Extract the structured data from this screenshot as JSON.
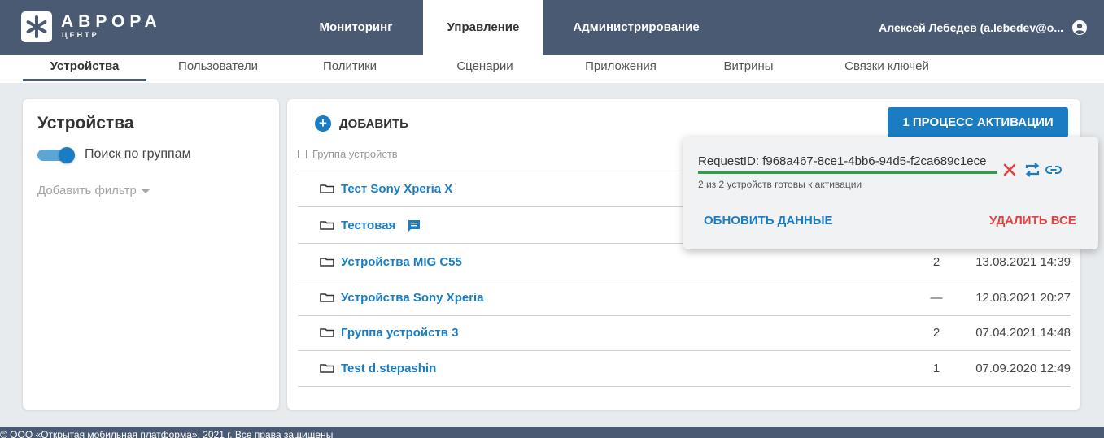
{
  "brand": {
    "title": "АВРОРА",
    "subtitle": "ЦЕНТР"
  },
  "main_nav": [
    {
      "label": "Мониторинг"
    },
    {
      "label": "Управление"
    },
    {
      "label": "Администрирование"
    }
  ],
  "user": {
    "name": "Алексей Лебедев (a.lebedev@o..."
  },
  "sub_nav": [
    {
      "label": "Устройства"
    },
    {
      "label": "Пользователи"
    },
    {
      "label": "Политики"
    },
    {
      "label": "Сценарии"
    },
    {
      "label": "Приложения"
    },
    {
      "label": "Витрины"
    },
    {
      "label": "Связки ключей"
    }
  ],
  "left_panel": {
    "title": "Устройства",
    "group_search_label": "Поиск по группам",
    "group_search_enabled": true,
    "add_filter_label": "Добавить фильтр"
  },
  "toolbar": {
    "add_label": "ДОБАВИТЬ",
    "activation_label": "1 ПРОЦЕСС АКТИВАЦИИ"
  },
  "table": {
    "header": "Группа устройств",
    "rows": [
      {
        "name": "Тест Sony Xperia X",
        "count": "",
        "date": ""
      },
      {
        "name": "Тестовая",
        "count": "",
        "date": "",
        "has_comment": true
      },
      {
        "name": "Устройства MIG C55",
        "count": "2",
        "date": "13.08.2021 14:39"
      },
      {
        "name": "Устройства Sony Xperia",
        "count": "—",
        "date": "12.08.2021 20:27"
      },
      {
        "name": "Группа устройств 3",
        "count": "2",
        "date": "07.04.2021 14:48"
      },
      {
        "name": "Test d.stepashin",
        "count": "1",
        "date": "07.09.2020 12:49"
      }
    ]
  },
  "popup": {
    "request_id": "RequestID: f968a467-8ce1-4bb6-94d5-f2ca689c1ece",
    "progress": 1.0,
    "ready_text": "2 из 2 устройств готовы к активации",
    "refresh_label": "ОБНОВИТЬ ДАННЫЕ",
    "delete_all_label": "УДАЛИТЬ ВСЕ"
  },
  "footer": {
    "text": "© ООО «Открытая мобильная платформа», 2021 г. Все права защищены"
  },
  "colors": {
    "header_bg": "#4b5a73",
    "accent": "#1a7dc4",
    "success": "#2f9d4a",
    "danger": "#e34242"
  },
  "icons": [
    "aurora-logo-icon",
    "user-account-icon",
    "plus-icon",
    "folder-icon",
    "comment-icon",
    "close-icon",
    "repeat-icon",
    "link-icon",
    "chevron-down-icon"
  ]
}
